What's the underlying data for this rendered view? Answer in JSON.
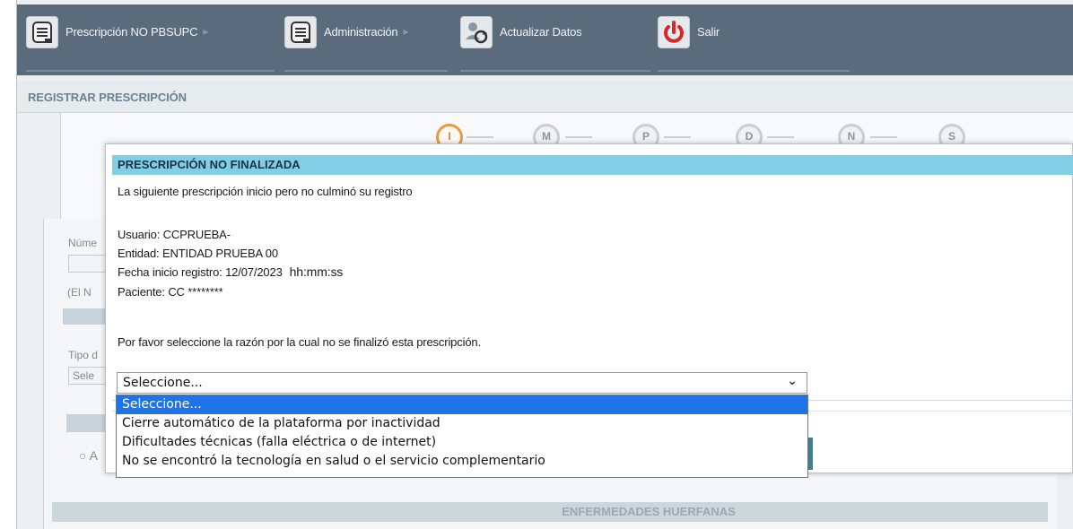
{
  "nav": {
    "items": [
      {
        "label": "Prescripción NO PBSUPC",
        "icon": "document-icon",
        "has_arrow": true
      },
      {
        "label": "Administración",
        "icon": "document-icon",
        "has_arrow": true
      },
      {
        "label": "Actualizar Datos",
        "icon": "user-refresh-icon",
        "has_arrow": false
      },
      {
        "label": "Salir",
        "icon": "power-icon",
        "has_arrow": false
      }
    ],
    "arrow": "▸"
  },
  "section_title": "REGISTRAR PRESCRIPCIÓN",
  "wizard_steps": [
    "I",
    "M",
    "P",
    "D",
    "N",
    "S"
  ],
  "background_form": {
    "numero_label": "Núme",
    "nota": "(El N",
    "tipo_label": "Tipo d",
    "tipo_value": "Sele",
    "radio": "○ A",
    "enfermedades": "ENFERMEDADES HUERFANAS"
  },
  "modal": {
    "title": "PRESCRIPCIÓN NO FINALIZADA",
    "intro": "La siguiente prescripción inicio pero no culminó su registro",
    "usuario": "Usuario: CCPRUEBA-",
    "entidad": "Entidad: ENTIDAD PRUEBA 00",
    "fecha": "Fecha inicio registro: 12/07/2023",
    "hora": "hh:mm:ss",
    "paciente": "Paciente: CC ********",
    "instruction": "Por favor seleccione la razón por la cual no se finalizó esta prescripción.",
    "select_value": "Seleccione...",
    "options": [
      "Seleccione...",
      "Cierre automático de la plataforma por inactividad",
      "Dificultades técnicas (falla eléctrica o de internet)",
      "No se encontró la tecnología en salud o el servicio complementario"
    ]
  },
  "colors": {
    "nav_bg": "#5a6b7b",
    "modal_header_bg": "#80cfe7",
    "selected_option_bg": "#1e73e8",
    "power_icon": "#d8262a",
    "active_step": "#e89a47"
  }
}
